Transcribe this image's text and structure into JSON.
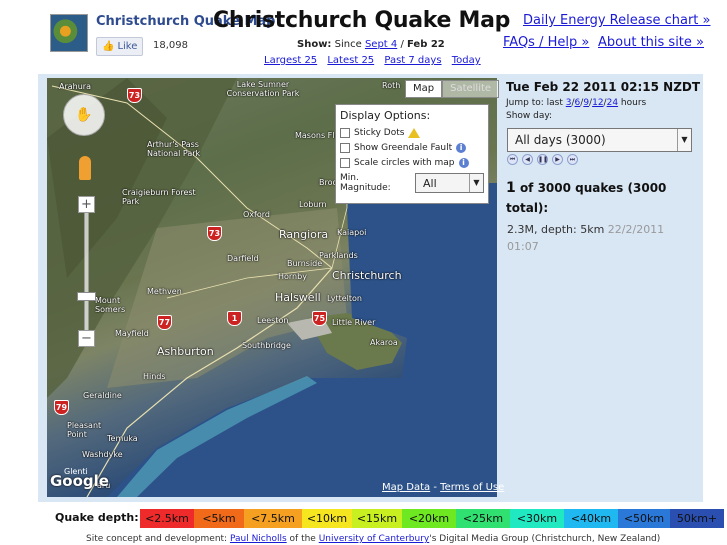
{
  "header": {
    "small_title": "Christchurch Quake Map",
    "big_title": "Christchurch Quake Map",
    "like_label": "Like",
    "like_count": "18,098",
    "show_label": "Show:",
    "since_label": "Since",
    "since_link": "Sept 4",
    "slash": "/",
    "to_label": "Feb 22",
    "range_links": [
      "Largest 25",
      "Latest 25",
      "Past 7 days",
      "Today"
    ],
    "nav": {
      "energy": "Daily Energy Release chart »",
      "faq": "FAQs / Help »",
      "about": "About this site »"
    }
  },
  "map": {
    "type_buttons": [
      "Map",
      "Satellite"
    ],
    "options": {
      "title": "Display Options:",
      "sticky": "Sticky Dots",
      "fault": "Show Greendale Fault",
      "scale": "Scale circles with map",
      "mag_label": "Min. Magnitude:",
      "mag_value": "All"
    },
    "map_data": "Map Data",
    "terms": "Terms of Use",
    "dash": "-",
    "google": "Google",
    "places": {
      "arahura": "Arahura",
      "lake_sumner": "Lake Sumner Conservation Park",
      "masons_flat": "Masons Flat",
      "arthurs_pass": "Arthur's Pass National Park",
      "craigieburn": "Craigieburn Forest Park",
      "broomfield": "Broomfield",
      "oxford": "Oxford",
      "loburn": "Loburn",
      "rangiora": "Rangiora",
      "kaiapoi": "Kaiapoi",
      "darfield": "Darfield",
      "burnside": "Burnside",
      "parklands": "Parklands",
      "hornby": "Hornby",
      "christchurch": "Christchurch",
      "halswell": "Halswell",
      "lyttelton": "Lyttelton",
      "methven": "Methven",
      "mount_somers": "Mount Somers",
      "mayfield": "Mayfield",
      "leeston": "Leeston",
      "little_river": "Little River",
      "akaroa": "Akaroa",
      "southbridge": "Southbridge",
      "ashburton": "Ashburton",
      "hinds": "Hinds",
      "geraldine": "Geraldine",
      "pleasant_point": "Pleasant Point",
      "temuka": "Temuka",
      "washdyke": "Washdyke",
      "glenti": "Glenti",
      "timaru": "aru",
      "rothe": "Roth"
    },
    "shields": {
      "s73a": "73",
      "s73b": "73",
      "s77": "77",
      "s1": "1",
      "s75": "75",
      "s79": "79"
    }
  },
  "side": {
    "date": "Tue Feb 22 2011 02:15 NZDT",
    "jump_prefix": "Jump to: last",
    "jump_links": [
      "3",
      "6",
      "9",
      "12",
      "24"
    ],
    "jump_suffix": "hours",
    "showday": "Show day:",
    "day_value": "All days (3000)",
    "count_n": "1",
    "count_text": "of 3000 quakes (3000 total):",
    "quake_desc": "2.3M, depth: 5km",
    "quake_when": "22/2/2011 01:07"
  },
  "legend": {
    "label": "Quake depth:",
    "items": [
      {
        "label": "<2.5km",
        "color": "#ee2a2a"
      },
      {
        "label": "<5km",
        "color": "#f06a1a"
      },
      {
        "label": "<7.5km",
        "color": "#f5a020"
      },
      {
        "label": "<10km",
        "color": "#f5e620"
      },
      {
        "label": "<15km",
        "color": "#c8f020"
      },
      {
        "label": "<20km",
        "color": "#6ee820"
      },
      {
        "label": "<25km",
        "color": "#30e070"
      },
      {
        "label": "<30km",
        "color": "#20e8c0"
      },
      {
        "label": "<40km",
        "color": "#20b8f0"
      },
      {
        "label": "<50km",
        "color": "#2a78d8"
      },
      {
        "label": "50km+",
        "color": "#2a4fb0"
      }
    ]
  },
  "footer": {
    "prefix": "Site concept and development:",
    "author": "Paul Nicholls",
    "of_the": "of the",
    "uni": "University of Canterbury",
    "suffix": "'s Digital Media Group (Christchurch, New Zealand)"
  }
}
